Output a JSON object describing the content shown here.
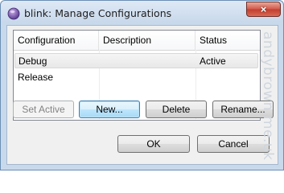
{
  "window": {
    "title": "blink: Manage Configurations",
    "close_label": "×"
  },
  "table": {
    "headers": [
      "Configuration",
      "Description",
      "Status"
    ],
    "rows": [
      {
        "configuration": "Debug",
        "description": "",
        "status": "Active",
        "selected": true
      },
      {
        "configuration": "Release",
        "description": "",
        "status": "",
        "selected": false
      }
    ]
  },
  "actions": {
    "set_active": "Set Active",
    "new": "New...",
    "delete": "Delete",
    "rename": "Rename..."
  },
  "footer": {
    "ok": "OK",
    "cancel": "Cancel"
  },
  "watermark": "andybrown.me.uk",
  "colors": {
    "title_bar": "#c9d9ec",
    "close_button": "#c23d2e",
    "default_button": "#3c7fb1"
  }
}
